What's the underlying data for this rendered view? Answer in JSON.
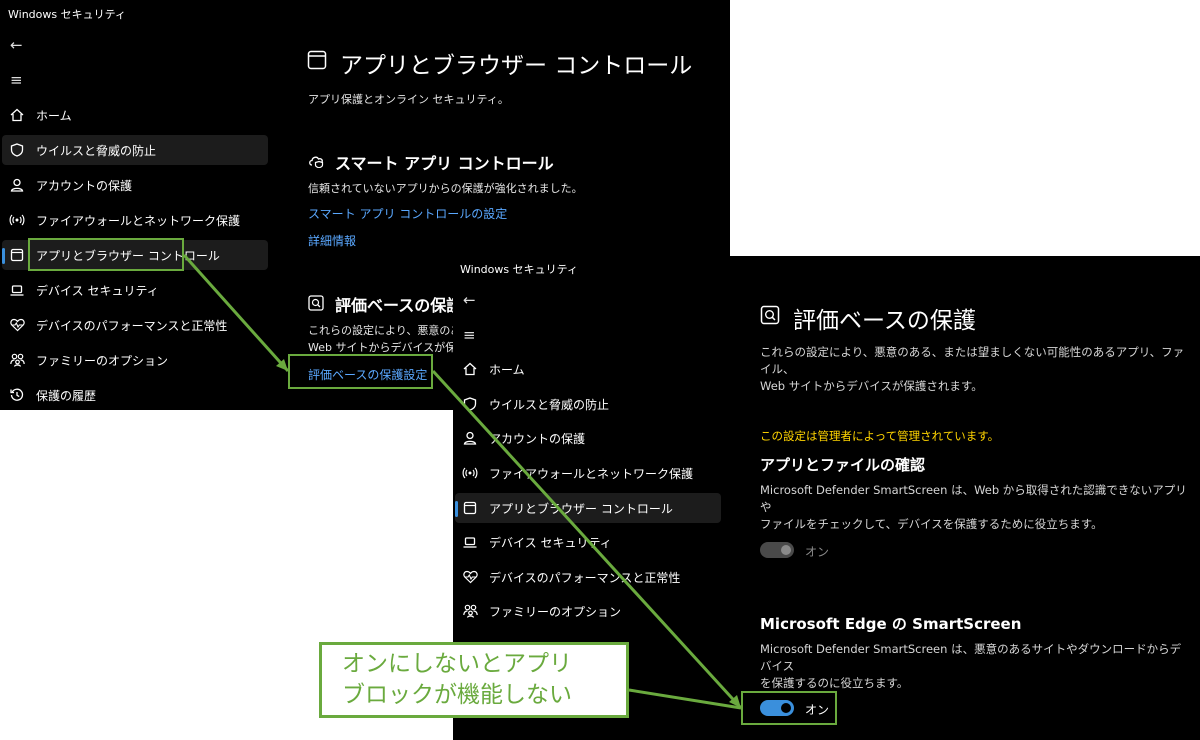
{
  "window1": {
    "title": "Windows セキュリティ",
    "nav": [
      {
        "label": "ホーム",
        "icon": "home-icon"
      },
      {
        "label": "ウイルスと脅威の防止",
        "icon": "shield-icon"
      },
      {
        "label": "アカウントの保護",
        "icon": "person-icon"
      },
      {
        "label": "ファイアウォールとネットワーク保護",
        "icon": "wifi-antenna-icon"
      },
      {
        "label": "アプリとブラウザー コントロール",
        "icon": "app-window-icon"
      },
      {
        "label": "デバイス セキュリティ",
        "icon": "laptop-icon"
      },
      {
        "label": "デバイスのパフォーマンスと正常性",
        "icon": "heart-pulse-icon"
      },
      {
        "label": "ファミリーのオプション",
        "icon": "family-icon"
      },
      {
        "label": "保護の履歴",
        "icon": "history-icon"
      }
    ],
    "page_title": "アプリとブラウザー コントロール",
    "page_subtitle": "アプリ保護とオンライン セキュリティ。",
    "smart_app": {
      "heading": "スマート アプリ コントロール",
      "desc": "信頼されていないアプリからの保護が強化されました。",
      "settings_link": "スマート アプリ コントロールの設定",
      "details_link": "詳細情報"
    },
    "reputation": {
      "heading": "評価ベースの保護",
      "desc_line1": "これらの設定により、悪意のあ",
      "desc_line2": "Web サイトからデバイスが保護",
      "settings_link": "評価ベースの保護設定"
    }
  },
  "window2": {
    "title": "Windows セキュリティ",
    "nav": [
      {
        "label": "ホーム",
        "icon": "home-icon"
      },
      {
        "label": "ウイルスと脅威の防止",
        "icon": "shield-icon"
      },
      {
        "label": "アカウントの保護",
        "icon": "person-icon"
      },
      {
        "label": "ファイアウォールとネットワーク保護",
        "icon": "wifi-antenna-icon"
      },
      {
        "label": "アプリとブラウザー コントロール",
        "icon": "app-window-icon"
      },
      {
        "label": "デバイス セキュリティ",
        "icon": "laptop-icon"
      },
      {
        "label": "デバイスのパフォーマンスと正常性",
        "icon": "heart-pulse-icon"
      },
      {
        "label": "ファミリーのオプション",
        "icon": "family-icon"
      }
    ],
    "page_title": "評価ベースの保護",
    "page_desc_line1": "これらの設定により、悪意のある、または望ましくない可能性のあるアプリ、ファイル、",
    "page_desc_line2": "Web サイトからデバイスが保護されます。",
    "managed_notice": "この設定は管理者によって管理されています。",
    "check_apps": {
      "heading": "アプリとファイルの確認",
      "desc_line1": "Microsoft Defender SmartScreen は、Web から取得された認識できないアプリや",
      "desc_line2": "ファイルをチェックして、デバイスを保護するために役立ちます。",
      "toggle_label": "オン",
      "toggle_on": true,
      "toggle_disabled": true
    },
    "edge": {
      "heading": "Microsoft Edge の SmartScreen",
      "desc_line1": "Microsoft Defender SmartScreen は、悪意のあるサイトやダウンロードからデバイス",
      "desc_line2": "を保護するのに役立ちます。",
      "toggle_label": "オン",
      "toggle_on": true,
      "toggle_disabled": false
    }
  },
  "callout": {
    "line1": "オンにしないとアプリ",
    "line2": "ブロックが機能しない"
  },
  "colors": {
    "accent": "#3a8fdc",
    "link": "#5aa8ff",
    "annotation_green": "#6aaa3e",
    "warning": "#ffd400"
  }
}
